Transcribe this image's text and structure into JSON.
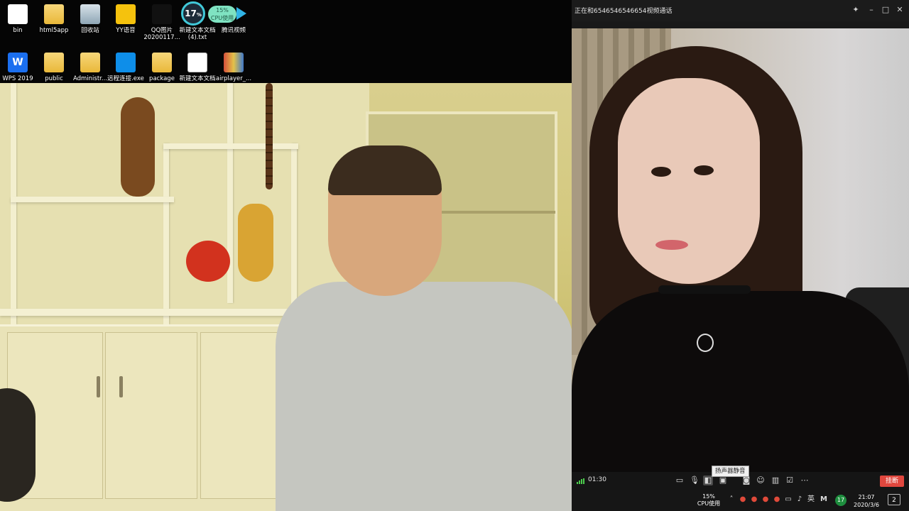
{
  "desktop_icons_row1": [
    {
      "label": "bin",
      "icon": "bin-icon"
    },
    {
      "label": "html5app",
      "icon": "folder-icon"
    },
    {
      "label": "回收站",
      "icon": "recycle-bin-icon"
    },
    {
      "label": "YY语音",
      "icon": "yy-voice-icon"
    },
    {
      "label": "QQ图片\n20200117...",
      "icon": "image-file-icon"
    },
    {
      "label": "新建文本文档\n(4).txt",
      "icon": "text-file-icon"
    },
    {
      "label": "腾讯视频",
      "icon": "tencent-video-icon"
    }
  ],
  "desktop_icons_row2": [
    {
      "label": "WPS 2019",
      "icon": "wps-icon"
    },
    {
      "label": "public",
      "icon": "folder-icon"
    },
    {
      "label": "Administr...",
      "icon": "folder-icon"
    },
    {
      "label": "远程连接.exe",
      "icon": "teamviewer-icon"
    },
    {
      "label": "package",
      "icon": "folder-icon"
    },
    {
      "label": "新建文本文档",
      "icon": "text-file-icon"
    },
    {
      "label": "airplayer_...",
      "icon": "winrar-archive-icon"
    }
  ],
  "cpu_gadget": {
    "percent": "17",
    "percent_unit": "%",
    "pill_percent": "15%",
    "pill_label": "CPU使用"
  },
  "call_window": {
    "title": "正在和6546546546654视频通话",
    "controls": {
      "timer": "01:30",
      "tooltip": "扬声器静音",
      "hangup_label": "挂断",
      "icons": [
        "chat-icon",
        "microphone-icon",
        "speaker-icon",
        "camera-icon",
        "screenshot-icon",
        "robot-icon",
        "layout-icon",
        "edit-icon",
        "more-icon"
      ]
    },
    "window_buttons": [
      "pin-icon",
      "minimize-icon",
      "maximize-icon",
      "close-icon"
    ]
  },
  "taskbar": {
    "cpu_percent": "15%",
    "cpu_label": "CPU使用",
    "ime_label": "英",
    "tray_badge": "17",
    "clock_time": "21:07",
    "clock_date": "2020/3/6",
    "notification_count": "2"
  },
  "colors": {
    "hangup": "#e0473e",
    "signal": "#4ccc4c",
    "cpu_ring": "#41c9d9",
    "cpu_pill": "#7fe3c2"
  }
}
